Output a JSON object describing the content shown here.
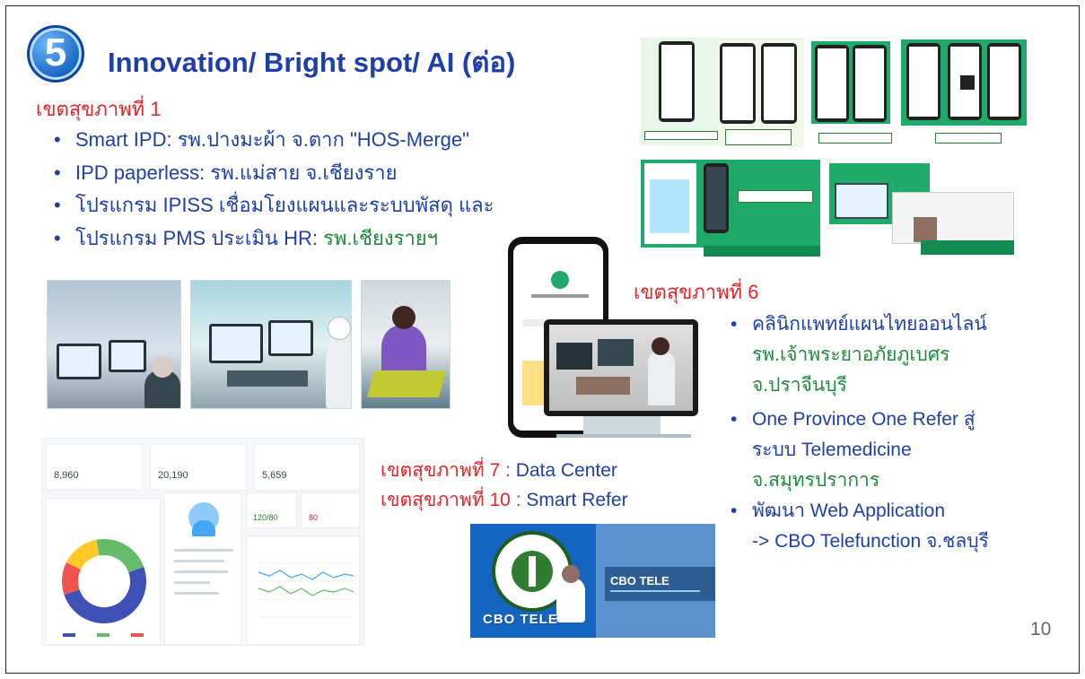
{
  "slide": {
    "number_badge": "5",
    "title": "Innovation/  Bright spot/ AI  (ต่อ)",
    "page_number": "10"
  },
  "region1": {
    "heading": "เขตสุขภาพที่ 1",
    "items": [
      {
        "label": "Smart IPD:",
        "detail": "รพ.ปางมะผ้า จ.ตาก \"HOS-Merge\""
      },
      {
        "label": "IPD paperless:",
        "detail": "รพ.แม่สาย จ.เชียงราย"
      },
      {
        "label": "โปรแกรม IPISS เชื่อมโยงแผนและระบบพัสดุ และ",
        "detail": ""
      },
      {
        "label": "โปรแกรม PMS ประเมิน HR:",
        "detail": "รพ.เชียงรายฯ"
      }
    ]
  },
  "region6": {
    "heading": "เขตสุขภาพที่ 6",
    "items": [
      {
        "line1": "คลินิกแพทย์แผนไทยออนไลน์",
        "line2": "รพ.เจ้าพระยาอภัยภูเบศร",
        "line3": "จ.ปราจีนบุรี"
      },
      {
        "line1": "One Province One Refer สู่",
        "line2": "ระบบ Telemedicine",
        "line3": "จ.สมุทรปราการ"
      },
      {
        "line1": "พัฒนา Web Application",
        "line2": "-> CBO Telefunction จ.ชลบุรี"
      }
    ]
  },
  "region7": {
    "heading": "เขตสุขภาพที่ 7 :",
    "detail": "Data Center"
  },
  "region10": {
    "heading": "เขตสุขภาพที่ 10 :",
    "detail": "Smart Refer"
  },
  "dashboard": {
    "stats": [
      "8,960",
      "20,190",
      "5,659"
    ],
    "chips": [
      "120/80",
      "80"
    ]
  },
  "cbo_banner": {
    "title": "CBO TELE",
    "logo_text": "CBO TELE"
  },
  "colors": {
    "title_blue": "#1f3fa8",
    "heading_red": "#e3262a",
    "detail_green": "#1f8a3a",
    "bullet_blue": "#1e40a8"
  }
}
